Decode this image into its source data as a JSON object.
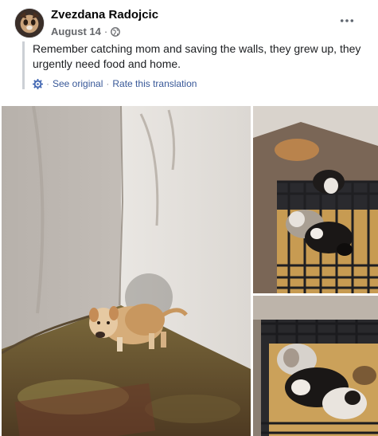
{
  "post": {
    "author": "Zvezdana Radojcic",
    "date": "August 14",
    "separator": "·",
    "privacy_icon": "globe-icon",
    "more_icon": "more-options-icon",
    "text": "Remember catching mom and saving the walls, they grew up, they urgently need food and home.",
    "translation": {
      "icon": "gear-icon",
      "see_original": "See original",
      "separator": "·",
      "rate": "Rate this translation"
    },
    "photos": [
      {
        "name": "photo-puppy-corner"
      },
      {
        "name": "photo-puppies-crate-top"
      },
      {
        "name": "photo-puppies-crate-bottom"
      }
    ]
  },
  "colors": {
    "link": "#385898",
    "meta": "#65676b",
    "quote_bar": "#ccd0d5"
  }
}
